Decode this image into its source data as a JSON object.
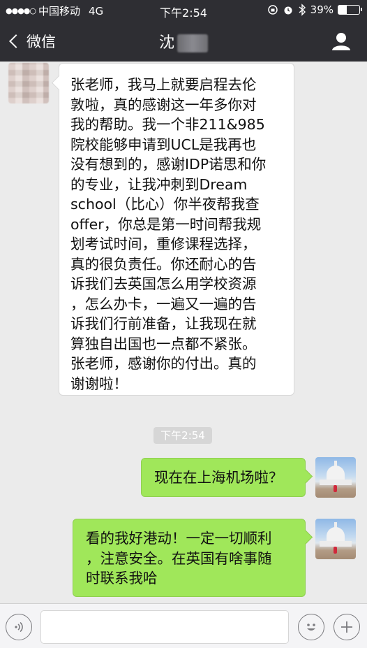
{
  "status_bar": {
    "signal": "●●●●○",
    "carrier": "中国移动",
    "network": "4G",
    "time": "下午2:54",
    "battery_percent": "39%",
    "battery_level": 0.39,
    "icons": [
      "orientation-lock-icon",
      "alarm-icon",
      "bluetooth-icon"
    ]
  },
  "nav": {
    "back_label": "微信",
    "title": "沈"
  },
  "messages": [
    {
      "side": "left",
      "text": "张老师，我马上就要启程去伦\n敦啦，真的感谢这一年多你对\n我的帮助。我一个非211&985\n院校能够申请到UCL是我再也\n没有想到的，感谢IDP诺思和你\n的专业，让我冲刺到Dream\nschool（比心）你半夜帮我查\noffer，你总是第一时间帮我规\n划考试时间，重修课程选择，\n真的很负责任。你还耐心的告\n诉我们去英国怎么用学校资源\n，怎么办卡，一遍又一遍的告\n诉我们行前准备，让我现在就\n算独自出国也一点都不紧张。\n张老师，感谢你的付出。真的\n谢谢啦！"
    },
    {
      "side": "right",
      "text": "现在在上海机场啦？"
    },
    {
      "side": "right",
      "text": "看的我好港动！一定一切顺利\n，注意安全。在英国有啥事随\n时联系我哈"
    }
  ],
  "timestamp": "下午2:54",
  "input_bar": {
    "voice_icon": "voice-icon",
    "emoji_icon": "emoji-icon",
    "add_icon": "plus-icon"
  },
  "colors": {
    "header_bg": "#2e2e33",
    "chat_bg": "#ebebeb",
    "sent_bubble": "#a0e75a",
    "received_bubble": "#ffffff"
  }
}
